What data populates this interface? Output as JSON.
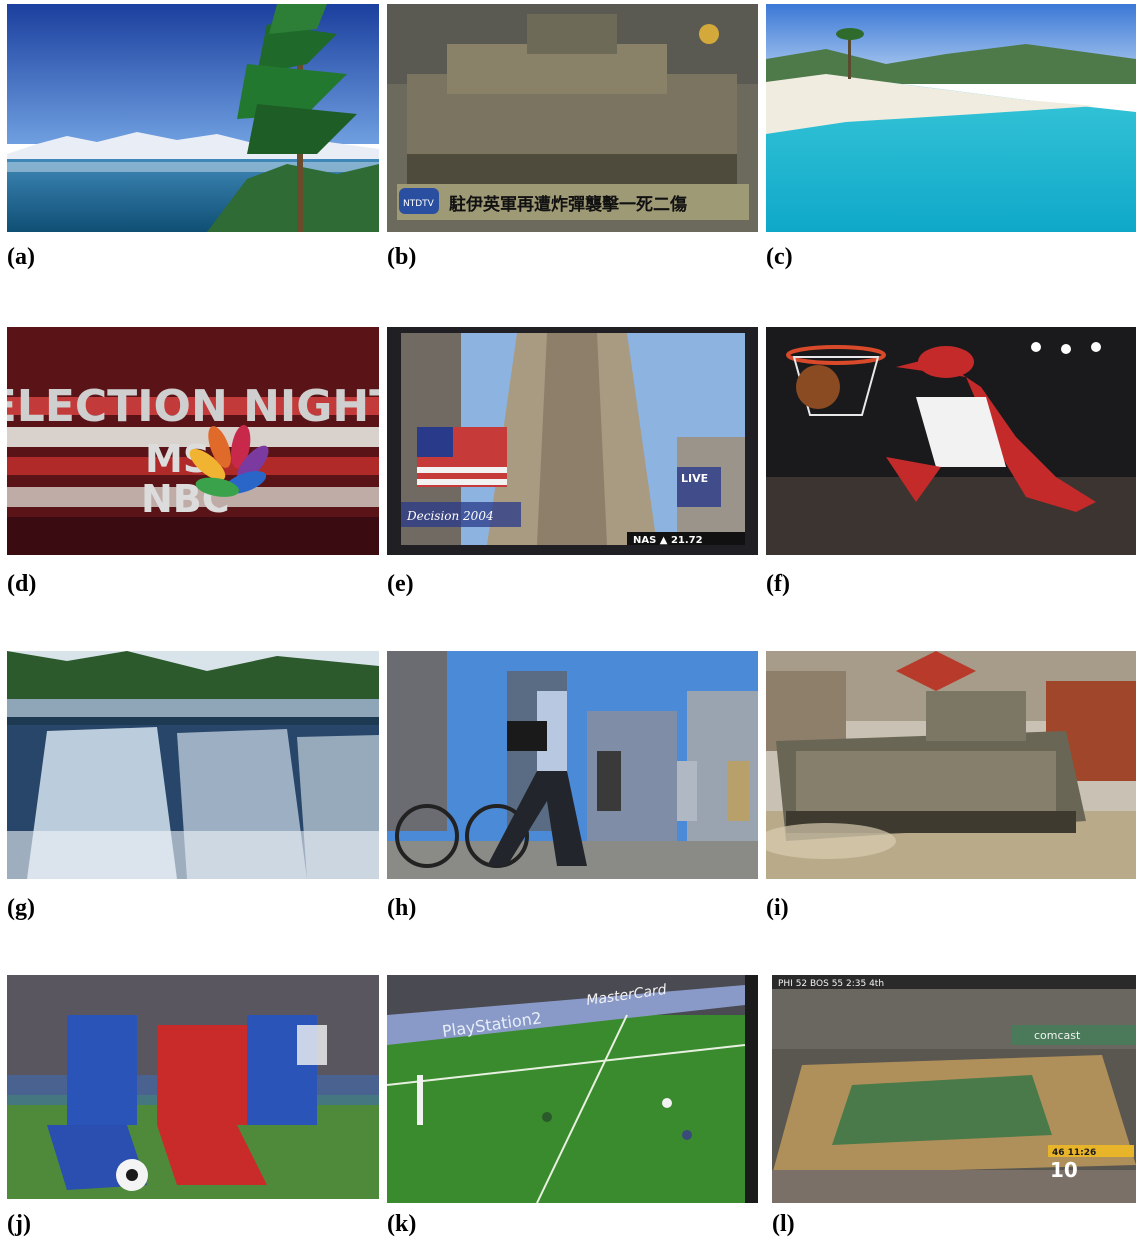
{
  "panels": [
    {
      "label": "(a)",
      "scene": "mountain lake with pine tree"
    },
    {
      "label": "(b)",
      "scene": "tank news broadcast",
      "caption": "駐伊英軍再遭炸彈襲擊一死二傷",
      "channel": "NTDTV"
    },
    {
      "label": "(c)",
      "scene": "tropical beach"
    },
    {
      "label": "(d)",
      "scene": "election night title card",
      "title": "ELECTION NIGHT",
      "brand1": "MS",
      "brand2": "NBC"
    },
    {
      "label": "(e)",
      "scene": "skyscraper with flags",
      "live": "LIVE",
      "ticker": "NAS ▲ 21.72",
      "decision": "Decision 2004"
    },
    {
      "label": "(f)",
      "scene": "mascot dunking basketball"
    },
    {
      "label": "(g)",
      "scene": "waterfall in forest"
    },
    {
      "label": "(h)",
      "scene": "city pedestrians and cyclist"
    },
    {
      "label": "(i)",
      "scene": "armored vehicle on street"
    },
    {
      "label": "(j)",
      "scene": "soccer players tackling"
    },
    {
      "label": "(k)",
      "scene": "soccer broadcast field",
      "ad1": "PlayStation2",
      "ad2": "MasterCard"
    },
    {
      "label": "(l)",
      "scene": "basketball broadcast",
      "score": "PHI 52 BOS 55 2:35 4th",
      "channel": "10",
      "clock": "46 11:26",
      "ad": "comcast"
    }
  ]
}
